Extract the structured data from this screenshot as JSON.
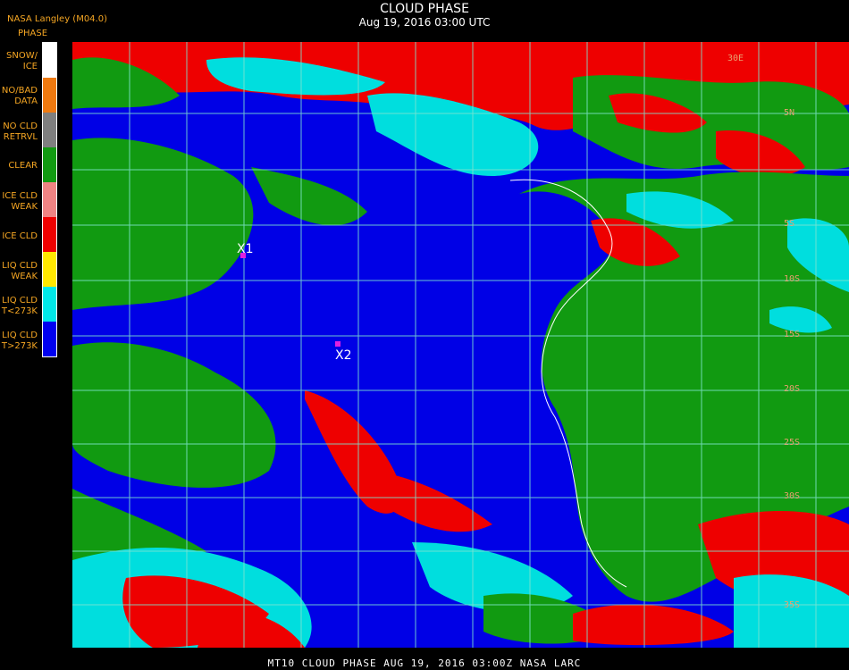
{
  "header": {
    "title": "CLOUD PHASE",
    "subtitle": "Aug 19, 2016 03:00 UTC",
    "source": "NASA Langley (M04.0)",
    "legend_title": "PHASE"
  },
  "legend": [
    {
      "label": "SNOW/\nICE",
      "color": "#ffffff"
    },
    {
      "label": "NO/BAD\nDATA",
      "color": "#f07a10"
    },
    {
      "label": "NO CLD\nRETRVL",
      "color": "#7f7f7f"
    },
    {
      "label": "CLEAR",
      "color": "#119a11"
    },
    {
      "label": "ICE CLD\nWEAK",
      "color": "#f08484"
    },
    {
      "label": "ICE CLD",
      "color": "#f00000"
    },
    {
      "label": "LIQ CLD\nWEAK",
      "color": "#ffe800"
    },
    {
      "label": "LIQ CLD\nT<273K",
      "color": "#00e8e8"
    },
    {
      "label": "LIQ CLD\nT>273K",
      "color": "#0000f0"
    }
  ],
  "markers": [
    {
      "label": "X1",
      "color": "#e020e0"
    },
    {
      "label": "X2",
      "color": "#e020e0"
    }
  ],
  "latitude_labels": [
    "5N",
    "5S",
    "10S",
    "15S",
    "20S",
    "25S",
    "30S",
    "35S"
  ],
  "longitude_labels": [
    "30E"
  ],
  "footer": "MT10  CLOUD PHASE   AUG 19, 2016 03:00Z   NASA LARC"
}
